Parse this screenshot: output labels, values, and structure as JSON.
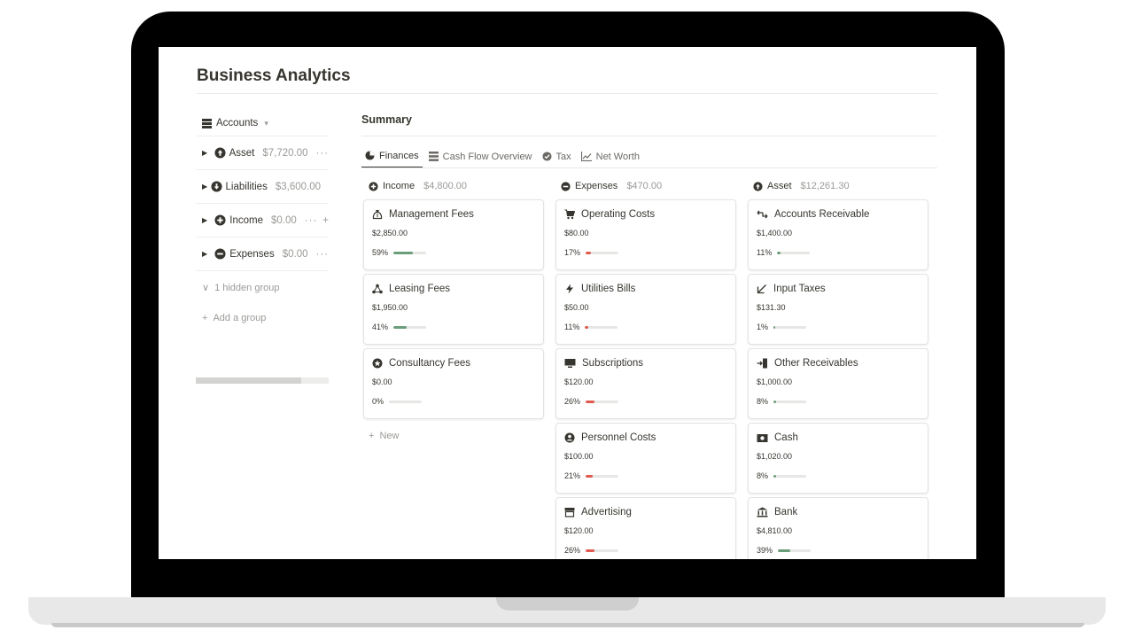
{
  "page": {
    "title": "Business Analytics"
  },
  "sidebar": {
    "header": "Accounts",
    "groups": [
      {
        "label": "Asset",
        "amount": "$7,720.00",
        "more": "···"
      },
      {
        "label": "Liabilities",
        "amount": "$3,600.00",
        "more": ""
      },
      {
        "label": "Income",
        "amount": "$0.00",
        "more": "···",
        "plus": "+"
      },
      {
        "label": "Expenses",
        "amount": "$0.00",
        "more": "···"
      }
    ],
    "hidden_group": "1 hidden group",
    "add_group": "Add a group"
  },
  "summary": {
    "title": "Summary",
    "tabs": [
      {
        "label": "Finances",
        "icon": "pie-chart-icon",
        "active": true
      },
      {
        "label": "Cash Flow Overview",
        "icon": "table-icon",
        "active": false
      },
      {
        "label": "Tax",
        "icon": "check-circle-icon",
        "active": false
      },
      {
        "label": "Net Worth",
        "icon": "line-chart-icon",
        "active": false
      }
    ]
  },
  "board": {
    "new_label": "New",
    "columns": [
      {
        "title": "Income",
        "amount": "$4,800.00",
        "icon": "plus-circle-icon",
        "cards": [
          {
            "title": "Management Fees",
            "icon": "money-bag-icon",
            "amount": "$2,850.00",
            "percent": "59%",
            "fraction": 0.59
          },
          {
            "title": "Leasing Fees",
            "icon": "share-nodes-icon",
            "amount": "$1,950.00",
            "percent": "41%",
            "fraction": 0.41
          },
          {
            "title": "Consultancy Fees",
            "icon": "star-circle-icon",
            "amount": "$0.00",
            "percent": "0%",
            "fraction": 0
          }
        ]
      },
      {
        "title": "Expenses",
        "amount": "$470.00",
        "icon": "minus-circle-icon",
        "cards": [
          {
            "title": "Operating Costs",
            "icon": "cart-icon",
            "amount": "$80.00",
            "percent": "17%",
            "fraction": 0.17
          },
          {
            "title": "Utilities Bills",
            "icon": "lightning-icon",
            "amount": "$50.00",
            "percent": "11%",
            "fraction": 0.11
          },
          {
            "title": "Subscriptions",
            "icon": "monitor-icon",
            "amount": "$120.00",
            "percent": "26%",
            "fraction": 0.26
          },
          {
            "title": "Personnel Costs",
            "icon": "person-circle-icon",
            "amount": "$100.00",
            "percent": "21%",
            "fraction": 0.21
          },
          {
            "title": "Advertising",
            "icon": "storefront-icon",
            "amount": "$120.00",
            "percent": "26%",
            "fraction": 0.26
          }
        ]
      },
      {
        "title": "Asset",
        "amount": "$12,261.30",
        "icon": "up-arrow-circle-icon",
        "cards": [
          {
            "title": "Accounts Receivable",
            "icon": "transfer-icon",
            "amount": "$1,400.00",
            "percent": "11%",
            "fraction": 0.11
          },
          {
            "title": "Input Taxes",
            "icon": "diagonal-arrow-icon",
            "amount": "$131.30",
            "percent": "1%",
            "fraction": 0.01
          },
          {
            "title": "Other Receivables",
            "icon": "door-enter-icon",
            "amount": "$1,000.00",
            "percent": "8%",
            "fraction": 0.08
          },
          {
            "title": "Cash",
            "icon": "banknote-icon",
            "amount": "$1,020.00",
            "percent": "8%",
            "fraction": 0.08
          },
          {
            "title": "Bank",
            "icon": "bank-icon",
            "amount": "$4,810.00",
            "percent": "39%",
            "fraction": 0.39
          }
        ]
      }
    ]
  },
  "colors": {
    "income_bar": "#6a9e7a",
    "expense_bar": "#e05a4f",
    "asset_bar": "#6a9e7a",
    "track": "#e6e6e4"
  }
}
